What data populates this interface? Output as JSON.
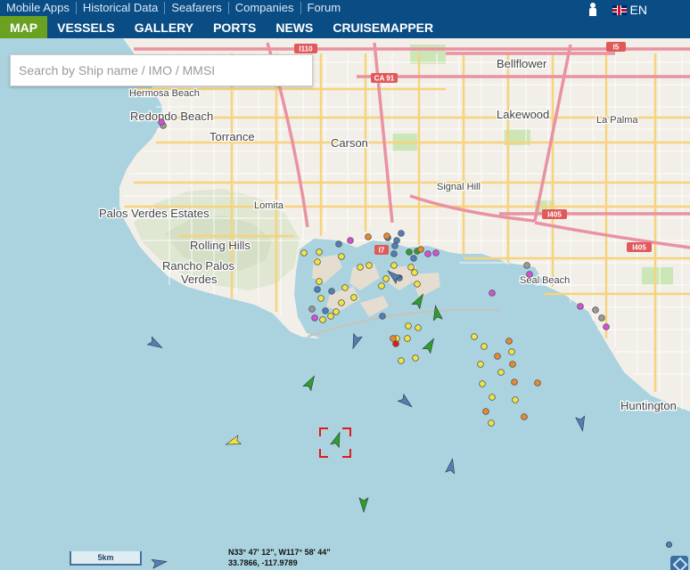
{
  "top_links": [
    "Mobile Apps",
    "Historical Data",
    "Seafarers",
    "Companies",
    "Forum"
  ],
  "language": "EN",
  "nav": [
    {
      "label": "MAP",
      "active": true
    },
    {
      "label": "VESSELS",
      "active": false
    },
    {
      "label": "GALLERY",
      "active": false
    },
    {
      "label": "PORTS",
      "active": false
    },
    {
      "label": "NEWS",
      "active": false
    },
    {
      "label": "CRUISEMAPPER",
      "active": false
    }
  ],
  "search": {
    "placeholder": "Search by Ship name / IMO / MMSI"
  },
  "place_labels": [
    {
      "id": "hermosa-beach",
      "text": "Hermosa Beach"
    },
    {
      "id": "redondo-beach",
      "text": "Redondo Beach"
    },
    {
      "id": "torrance",
      "text": "Torrance"
    },
    {
      "id": "carson",
      "text": "Carson"
    },
    {
      "id": "bellflower",
      "text": "Bellflower"
    },
    {
      "id": "lakewood",
      "text": "Lakewood"
    },
    {
      "id": "la-palma",
      "text": "La Palma"
    },
    {
      "id": "signal-hill",
      "text": "Signal Hill"
    },
    {
      "id": "lomita",
      "text": "Lomita"
    },
    {
      "id": "palos-verdes-estates",
      "text": "Palos Verdes Estates"
    },
    {
      "id": "rolling-hills",
      "text": "Rolling Hills"
    },
    {
      "id": "rancho-palos",
      "text": "Rancho Palos"
    },
    {
      "id": "verdes",
      "text": "Verdes"
    },
    {
      "id": "seal-beach",
      "text": "Seal Beach"
    },
    {
      "id": "huntington",
      "text": "Huntington"
    }
  ],
  "road_shields": [
    {
      "id": "i110",
      "text": "I110"
    },
    {
      "id": "i5",
      "text": "I5"
    },
    {
      "id": "ca91",
      "text": "CA 91"
    },
    {
      "id": "i405-a",
      "text": "I405"
    },
    {
      "id": "i405-b",
      "text": "I405"
    },
    {
      "id": "i7",
      "text": "I7"
    }
  ],
  "scale": "5km",
  "coordinates": {
    "dms": "N33° 47' 12\", W117° 58' 44\"",
    "decimal": "33.7866, -117.9789"
  },
  "colors": {
    "water": "#aad3df",
    "land": "#f2efe9",
    "nav_bg": "#0a4d85",
    "nav_active": "#6aa121",
    "tanker": "#f0e442",
    "cargo": "#4f7fb8",
    "passenger": "#2ca02c",
    "tug": "#e8892b",
    "pleasure": "#d64fd6",
    "unknown": "#999999",
    "selection": "#e21a1a"
  },
  "vessel_markers": [
    {
      "type": "cargo",
      "heading": 120
    },
    {
      "type": "passenger",
      "heading": 30
    },
    {
      "type": "tanker",
      "heading": 250
    },
    {
      "type": "passenger",
      "heading": 20
    },
    {
      "type": "cargo",
      "heading": 200
    },
    {
      "type": "cargo",
      "heading": 130
    },
    {
      "type": "passenger",
      "heading": 350
    },
    {
      "type": "passenger",
      "heading": 30
    },
    {
      "type": "cargo",
      "heading": 10
    },
    {
      "type": "cargo",
      "heading": 170
    },
    {
      "type": "passenger",
      "heading": 180
    },
    {
      "type": "cargo",
      "heading": 80
    },
    {
      "type": "cargo",
      "heading": 310
    },
    {
      "type": "passenger",
      "heading": 30
    }
  ]
}
